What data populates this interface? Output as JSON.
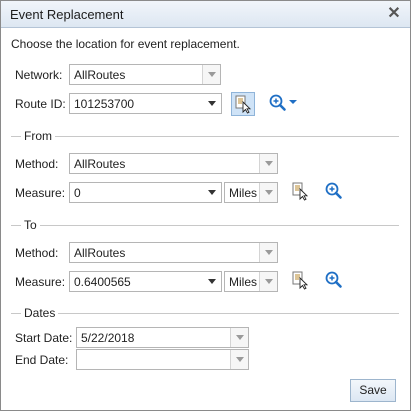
{
  "dialog": {
    "title": "Event Replacement",
    "close_icon": "close-icon",
    "instruction": "Choose the location for event replacement."
  },
  "network": {
    "label": "Network:",
    "value": "AllRoutes"
  },
  "route": {
    "label": "Route ID:",
    "value": "101253700"
  },
  "from": {
    "section_title": "From",
    "method_label": "Method:",
    "method_value": "AllRoutes",
    "measure_label": "Measure:",
    "measure_value": "0",
    "units_value": "Miles"
  },
  "to": {
    "section_title": "To",
    "method_label": "Method:",
    "method_value": "AllRoutes",
    "measure_label": "Measure:",
    "measure_value": "0.6400565",
    "units_value": "Miles"
  },
  "dates": {
    "section_title": "Dates",
    "start_label": "Start Date:",
    "start_value": "5/22/2018",
    "end_label": "End Date:",
    "end_value": ""
  },
  "buttons": {
    "save": "Save"
  },
  "colors": {
    "title_bar": "#dde7f2",
    "active_tool": "#cfe3f7",
    "accent": "#1f6fc5"
  }
}
